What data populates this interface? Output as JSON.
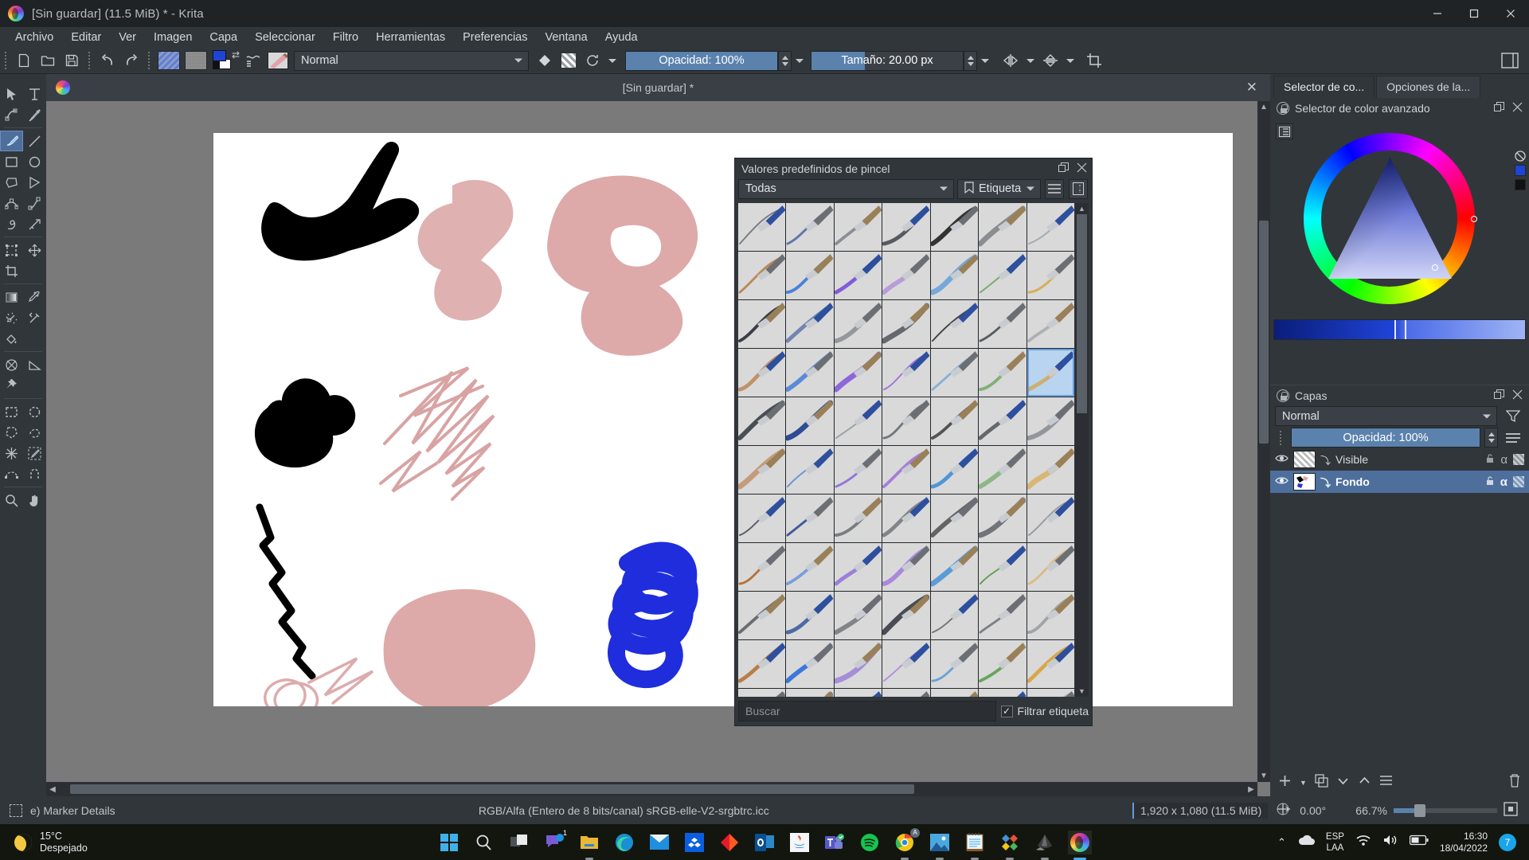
{
  "window": {
    "title": "[Sin guardar]  (11.5 MiB)  * - Krita",
    "minimize": "—",
    "maximize": "▢",
    "close": "✕"
  },
  "menu": {
    "items": [
      "Archivo",
      "Editar",
      "Ver",
      "Imagen",
      "Capa",
      "Seleccionar",
      "Filtro",
      "Herramientas",
      "Preferencias",
      "Ventana",
      "Ayuda"
    ]
  },
  "toolbar": {
    "new_icon": "new-document-icon",
    "open_icon": "open-folder-icon",
    "save_icon": "save-disk-icon",
    "undo_icon": "undo-arrow-icon",
    "redo_icon": "redo-arrow-icon",
    "pattern_icon": "pattern-swatch",
    "gradient_icon": "gradient-swatch",
    "blend_label": "Normal",
    "eraser_icon": "eraser-icon",
    "alpha_icon": "alpha-lock-icon",
    "reload_icon": "reload-preset-icon",
    "opacity_label": "Opacidad: 100%",
    "opacity_value": 100,
    "size_label": "Tamaño: 20.00 px",
    "size_value": 20.0,
    "mirror_h_icon": "mirror-horizontal-icon",
    "mirror_v_icon": "mirror-vertical-icon",
    "wraparound_icon": "crop-wraparound-icon",
    "showdock_icon": "show-dockers-icon"
  },
  "toolbox": {
    "tools": [
      {
        "name": "shape-select-tool",
        "icon": "cursor-arrow"
      },
      {
        "name": "text-tool",
        "icon": "text-T"
      },
      {
        "name": "edit-shapes-tool",
        "icon": "node-edit"
      },
      {
        "name": "calligraphy-tool",
        "icon": "calligraphy-pen"
      },
      {
        "name": "freehand-brush-tool",
        "icon": "paint-brush",
        "selected": true
      },
      {
        "name": "line-tool",
        "icon": "line"
      },
      {
        "name": "rectangle-tool",
        "icon": "rectangle"
      },
      {
        "name": "ellipse-tool",
        "icon": "ellipse"
      },
      {
        "name": "polygon-tool",
        "icon": "polygon"
      },
      {
        "name": "polyline-tool",
        "icon": "polyline"
      },
      {
        "name": "bezier-curve-tool",
        "icon": "bezier-curve"
      },
      {
        "name": "freehand-path-tool",
        "icon": "freehand-path"
      },
      {
        "name": "dynamic-brush-tool",
        "icon": "dynamic-brush"
      },
      {
        "name": "multibrush-tool",
        "icon": "multibrush"
      },
      {
        "name": "transform-tool",
        "icon": "transform-frame"
      },
      {
        "name": "move-tool",
        "icon": "move-cross"
      },
      {
        "name": "crop-tool",
        "icon": "crop"
      },
      {
        "name": "gradient-tool",
        "icon": "gradient-box"
      },
      {
        "name": "color-picker-tool",
        "icon": "eyedropper"
      },
      {
        "name": "colorize-mask-tool",
        "icon": "colorize-sparkle"
      },
      {
        "name": "smart-patch-tool",
        "icon": "smart-patch"
      },
      {
        "name": "fill-tool",
        "icon": "paint-bucket"
      },
      {
        "name": "enclose-fill-tool",
        "icon": "enclose-fill"
      },
      {
        "name": "measure-tool",
        "icon": "measure-angle"
      },
      {
        "name": "reference-images-tool",
        "icon": "pin"
      },
      {
        "name": "rectangular-select-tool",
        "icon": "select-rectangle"
      },
      {
        "name": "elliptical-select-tool",
        "icon": "select-ellipse"
      },
      {
        "name": "polygonal-select-tool",
        "icon": "select-polygon"
      },
      {
        "name": "freehand-select-tool",
        "icon": "select-freehand"
      },
      {
        "name": "contiguous-select-tool",
        "icon": "select-magic"
      },
      {
        "name": "similar-color-select-tool",
        "icon": "select-similar"
      },
      {
        "name": "bezier-select-tool",
        "icon": "select-bezier"
      },
      {
        "name": "magnetic-select-tool",
        "icon": "select-magnetic"
      },
      {
        "name": "zoom-tool",
        "icon": "magnifier"
      },
      {
        "name": "pan-tool",
        "icon": "hand"
      }
    ]
  },
  "canvas": {
    "tab_title": "[Sin guardar]  *",
    "close_label": "✕",
    "document_width": 1280,
    "document_height": 720
  },
  "brush_docker": {
    "title": "Valores predefinidos de pincel",
    "float_icon": "float-docker-icon",
    "close_icon": "close-icon",
    "tag_filter_value": "Todas",
    "tag_button_label": "Etiqueta",
    "tag_icon": "bookmark-icon",
    "list_view_icon": "list-view-icon",
    "settings_icon": "preset-settings-icon",
    "search_placeholder": "Buscar",
    "filter_tag_label": "Filtrar etiqueta",
    "filter_tag_checked": true,
    "selected_cell_index": 27,
    "rows": 11,
    "cols": 7
  },
  "right_dock": {
    "tabs": [
      {
        "label": "Selector de co...",
        "active": true
      },
      {
        "label": "Opciones de la...",
        "active": false
      }
    ],
    "color_selector": {
      "title": "Selector de color avanzado",
      "lock_icon": "lock-docker-icon",
      "float_icon": "float-docker-icon",
      "close_icon": "close-icon",
      "settings_icon": "selector-settings-icon",
      "no_color_icon": "no-color-icon",
      "fg_color": "#1f44d8",
      "bg_color": "#000000"
    },
    "layers": {
      "title": "Capas",
      "lock_icon": "lock-docker-icon",
      "float_icon": "float-docker-icon",
      "close_icon": "close-icon",
      "blend_mode": "Normal",
      "filter_icon": "filter-funnel-icon",
      "menu_icon": "hamburger-menu-icon",
      "opacity_label": "Opacidad:  100%",
      "opacity_value": 100,
      "rows": [
        {
          "name": "Visible",
          "selected": false,
          "visible": true,
          "alpha_icon": "α",
          "lock_icon": "lock-icon",
          "inherit_icon": "inherit-alpha-icon"
        },
        {
          "name": "Fondo",
          "selected": true,
          "visible": true,
          "alpha_icon": "α",
          "lock_icon": "lock-icon",
          "inherit_icon": "inherit-alpha-icon"
        }
      ],
      "bottom_buttons": [
        {
          "name": "add-layer-button",
          "icon": "plus"
        },
        {
          "name": "duplicate-layer-button",
          "icon": "copy"
        },
        {
          "name": "move-layer-down-button",
          "icon": "chevron-down"
        },
        {
          "name": "move-layer-up-button",
          "icon": "chevron-up"
        },
        {
          "name": "layer-properties-button",
          "icon": "properties"
        },
        {
          "name": "delete-layer-button",
          "icon": "trash"
        }
      ]
    }
  },
  "status_bar": {
    "selection_icon": "selection-icon",
    "preset_name": "e) Marker Details",
    "color_space": "RGB/Alfa (Entero de 8 bits/canal)  sRGB-elle-V2-srgbtrc.icc",
    "dimensions": "1,920 x 1,080 (11.5 MiB)",
    "rotation_icon": "canvas-rotation-icon",
    "rotation": "0.00°",
    "zoom": "66.7%",
    "fit_icon": "fit-page-icon"
  },
  "taskbar": {
    "weather_temp": "15°C",
    "weather_desc": "Despejado",
    "weather_icon": "moon-icon",
    "apps": [
      {
        "name": "start-button",
        "icon": "windows-logo"
      },
      {
        "name": "search-button",
        "icon": "search-icon"
      },
      {
        "name": "task-view-button",
        "icon": "task-view-icon"
      },
      {
        "name": "chat-button",
        "icon": "chat-icon",
        "badge": "1"
      },
      {
        "name": "file-explorer-button",
        "icon": "folder-icon",
        "running": true
      },
      {
        "name": "edge-button",
        "icon": "edge-icon"
      },
      {
        "name": "mail-button",
        "icon": "mail-icon"
      },
      {
        "name": "dropbox-button",
        "icon": "dropbox-icon"
      },
      {
        "name": "acrobat-button",
        "icon": "acrobat-icon"
      },
      {
        "name": "outlook-button",
        "icon": "outlook-icon"
      },
      {
        "name": "java-button",
        "icon": "java-icon"
      },
      {
        "name": "teams-button",
        "icon": "teams-icon",
        "running": true
      },
      {
        "name": "spotify-button",
        "icon": "spotify-icon",
        "running": true
      },
      {
        "name": "chrome-button",
        "icon": "chrome-icon",
        "running": true
      },
      {
        "name": "photos-button",
        "icon": "photos-icon",
        "running": true
      },
      {
        "name": "notepad-button",
        "icon": "notepad-icon",
        "running": true
      },
      {
        "name": "affinity-button",
        "icon": "affinity-icon",
        "running": true
      },
      {
        "name": "inkscape-button",
        "icon": "inkscape-icon",
        "running": true
      },
      {
        "name": "krita-button",
        "icon": "krita-icon",
        "running": true,
        "active": true
      }
    ],
    "tray": {
      "overflow_icon": "chevron-up-icon",
      "onedrive_icon": "onedrive-cloud-icon",
      "language_line1": "ESP",
      "language_line2": "LAA",
      "wifi_icon": "wifi-icon",
      "volume_icon": "volume-icon",
      "battery_icon": "battery-icon",
      "time": "16:30",
      "date": "18/04/2022",
      "notification_count": "7"
    }
  }
}
